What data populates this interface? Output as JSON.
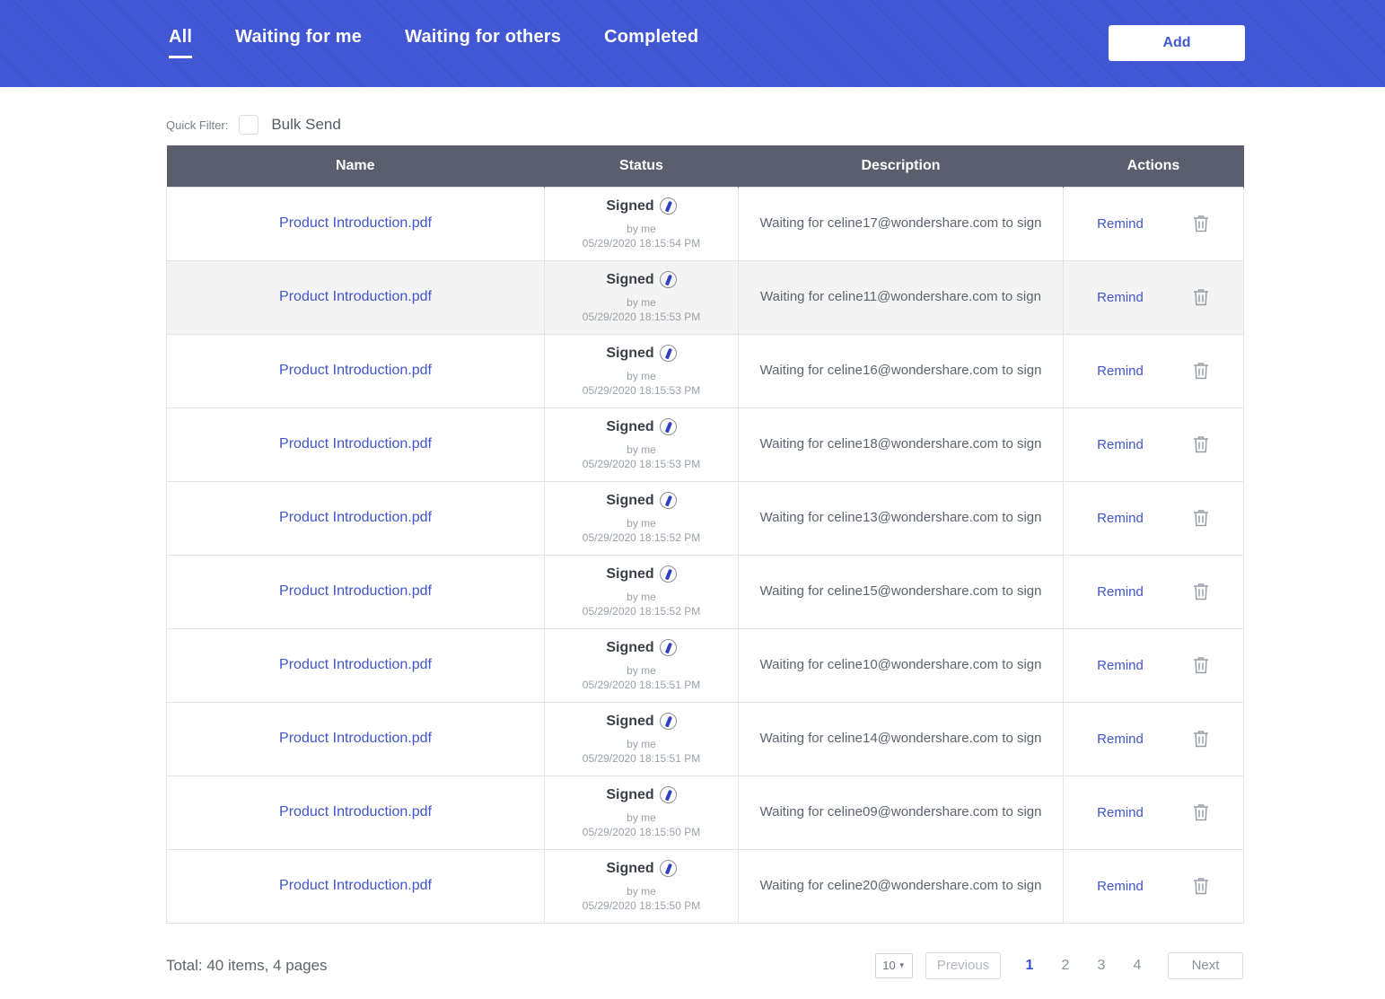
{
  "header": {
    "accent_color": "#4257d4",
    "tabs": [
      {
        "label": "All",
        "active": true
      },
      {
        "label": "Waiting for me",
        "active": false
      },
      {
        "label": "Waiting for others",
        "active": false
      },
      {
        "label": "Completed",
        "active": false
      }
    ],
    "add_label": "Add"
  },
  "quick_filter": {
    "label": "Quick Filter:",
    "checkbox_label": "Bulk Send",
    "checked": false
  },
  "table": {
    "columns": [
      "Name",
      "Status",
      "Description",
      "Actions"
    ],
    "status_label": "Signed",
    "status_by": "by me",
    "remind_label": "Remind",
    "rows": [
      {
        "name": "Product Introduction.pdf",
        "status": "Signed",
        "by": "by me",
        "time": "05/29/2020 18:15:54 PM",
        "description": "Waiting for celine17@wondershare.com to sign",
        "action": "Remind",
        "highlighted": false
      },
      {
        "name": "Product Introduction.pdf",
        "status": "Signed",
        "by": "by me",
        "time": "05/29/2020 18:15:53 PM",
        "description": "Waiting for celine11@wondershare.com to sign",
        "action": "Remind",
        "highlighted": true
      },
      {
        "name": "Product Introduction.pdf",
        "status": "Signed",
        "by": "by me",
        "time": "05/29/2020 18:15:53 PM",
        "description": "Waiting for celine16@wondershare.com to sign",
        "action": "Remind",
        "highlighted": false
      },
      {
        "name": "Product Introduction.pdf",
        "status": "Signed",
        "by": "by me",
        "time": "05/29/2020 18:15:53 PM",
        "description": "Waiting for celine18@wondershare.com to sign",
        "action": "Remind",
        "highlighted": false
      },
      {
        "name": "Product Introduction.pdf",
        "status": "Signed",
        "by": "by me",
        "time": "05/29/2020 18:15:52 PM",
        "description": "Waiting for celine13@wondershare.com to sign",
        "action": "Remind",
        "highlighted": false
      },
      {
        "name": "Product Introduction.pdf",
        "status": "Signed",
        "by": "by me",
        "time": "05/29/2020 18:15:52 PM",
        "description": "Waiting for celine15@wondershare.com to sign",
        "action": "Remind",
        "highlighted": false
      },
      {
        "name": "Product Introduction.pdf",
        "status": "Signed",
        "by": "by me",
        "time": "05/29/2020 18:15:51 PM",
        "description": "Waiting for celine10@wondershare.com to sign",
        "action": "Remind",
        "highlighted": false
      },
      {
        "name": "Product Introduction.pdf",
        "status": "Signed",
        "by": "by me",
        "time": "05/29/2020 18:15:51 PM",
        "description": "Waiting for celine14@wondershare.com to sign",
        "action": "Remind",
        "highlighted": false
      },
      {
        "name": "Product Introduction.pdf",
        "status": "Signed",
        "by": "by me",
        "time": "05/29/2020 18:15:50 PM",
        "description": "Waiting for celine09@wondershare.com to sign",
        "action": "Remind",
        "highlighted": false
      },
      {
        "name": "Product Introduction.pdf",
        "status": "Signed",
        "by": "by me",
        "time": "05/29/2020 18:15:50 PM",
        "description": "Waiting for celine20@wondershare.com to sign",
        "action": "Remind",
        "highlighted": false
      }
    ]
  },
  "footer": {
    "total_text": "Total: 40 items, 4 pages",
    "page_size": "10",
    "previous_label": "Previous",
    "next_label": "Next",
    "pages": [
      "1",
      "2",
      "3",
      "4"
    ],
    "current_page": "1"
  }
}
